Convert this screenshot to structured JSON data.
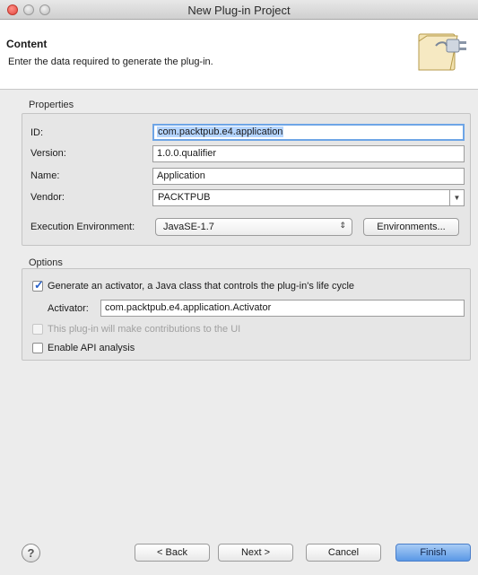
{
  "window": {
    "title": "New Plug-in Project"
  },
  "header": {
    "title": "Content",
    "description": "Enter the data required to generate the plug-in."
  },
  "properties": {
    "section_title": "Properties",
    "id": {
      "label": "ID:",
      "value": "com.packtpub.e4.application"
    },
    "version": {
      "label": "Version:",
      "value": "1.0.0.qualifier"
    },
    "name": {
      "label": "Name:",
      "value": "Application"
    },
    "vendor": {
      "label": "Vendor:",
      "value": "PACKTPUB"
    },
    "exec_env": {
      "label": "Execution Environment:",
      "value": "JavaSE-1.7",
      "button": "Environments..."
    }
  },
  "options": {
    "section_title": "Options",
    "generate_activator": {
      "label": "Generate an activator, a Java class that controls the plug-in's life cycle",
      "checked": true
    },
    "activator": {
      "label": "Activator:",
      "value": "com.packtpub.e4.application.Activator"
    },
    "ui_contrib": {
      "label": "This plug-in will make contributions to the UI",
      "checked": false,
      "enabled": false
    },
    "api_analysis": {
      "label": "Enable API analysis",
      "checked": false
    }
  },
  "footer": {
    "help_icon": "?",
    "back": "< Back",
    "next": "Next >",
    "cancel": "Cancel",
    "finish": "Finish"
  },
  "colors": {
    "accent": "#5a98e6",
    "focus_ring": "#6ea5e6"
  },
  "icons": [
    "close-icon",
    "minimize-icon",
    "zoom-icon",
    "folder-plug-icon",
    "help-icon",
    "checkmark-icon",
    "dropdown-arrow-icon"
  ]
}
